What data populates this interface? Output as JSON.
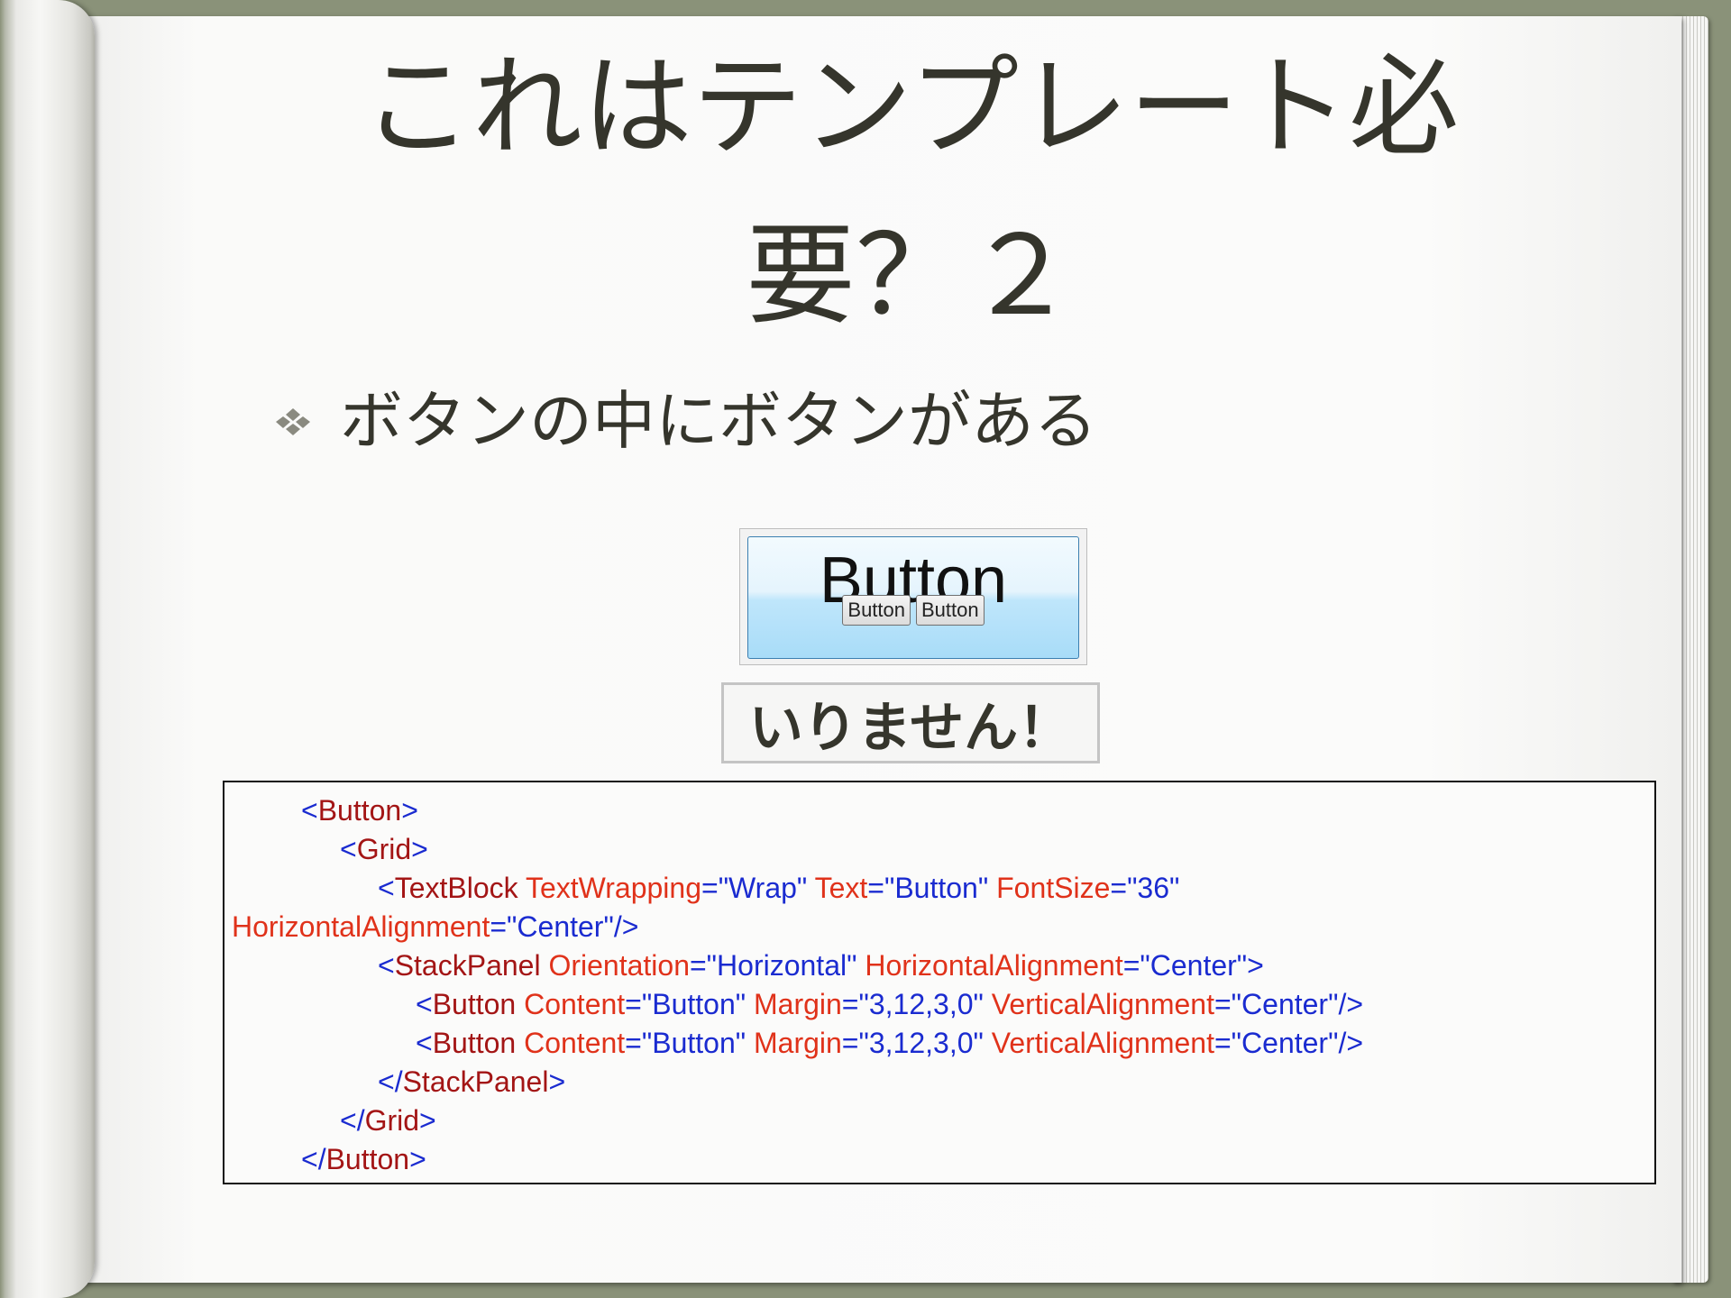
{
  "slide": {
    "title_line1": "これはテンプレート必",
    "title_line2": "要？２",
    "bullet_text": "ボタンの中にボタンがある",
    "bullet_icon": "diamond-cluster-icon"
  },
  "demo": {
    "big_text": "Button",
    "inner_buttons": [
      "Button",
      "Button"
    ]
  },
  "caption": "いりません！",
  "code_lines": [
    {
      "indent": 85,
      "tokens": [
        [
          "p",
          "<"
        ],
        [
          "t",
          "Button"
        ],
        [
          "p",
          ">"
        ]
      ]
    },
    {
      "indent": 128,
      "tokens": [
        [
          "p",
          "<"
        ],
        [
          "t",
          "Grid"
        ],
        [
          "p",
          ">"
        ]
      ]
    },
    {
      "indent": 170,
      "tokens": [
        [
          "p",
          "<"
        ],
        [
          "t",
          "TextBlock"
        ],
        [
          "p",
          " "
        ],
        [
          "a",
          "TextWrapping"
        ],
        [
          "p",
          "=\""
        ],
        [
          "v",
          "Wrap"
        ],
        [
          "p",
          "\" "
        ],
        [
          "a",
          "Text"
        ],
        [
          "p",
          "=\""
        ],
        [
          "v",
          "Button"
        ],
        [
          "p",
          "\" "
        ],
        [
          "a",
          "FontSize"
        ],
        [
          "p",
          "=\""
        ],
        [
          "v",
          "36"
        ],
        [
          "p",
          "\""
        ]
      ]
    },
    {
      "indent": 8,
      "tokens": [
        [
          "a",
          "HorizontalAlignment"
        ],
        [
          "p",
          "=\""
        ],
        [
          "v",
          "Center"
        ],
        [
          "p",
          "\"/>"
        ]
      ]
    },
    {
      "indent": 170,
      "tokens": [
        [
          "p",
          "<"
        ],
        [
          "t",
          "StackPanel"
        ],
        [
          "p",
          " "
        ],
        [
          "a",
          "Orientation"
        ],
        [
          "p",
          "=\""
        ],
        [
          "v",
          "Horizontal"
        ],
        [
          "p",
          "\" "
        ],
        [
          "a",
          "HorizontalAlignment"
        ],
        [
          "p",
          "=\""
        ],
        [
          "v",
          "Center"
        ],
        [
          "p",
          "\">"
        ]
      ]
    },
    {
      "indent": 212,
      "tokens": [
        [
          "p",
          "<"
        ],
        [
          "t",
          "Button"
        ],
        [
          "p",
          " "
        ],
        [
          "a",
          "Content"
        ],
        [
          "p",
          "=\""
        ],
        [
          "v",
          "Button"
        ],
        [
          "p",
          "\" "
        ],
        [
          "a",
          "Margin"
        ],
        [
          "p",
          "=\""
        ],
        [
          "v",
          "3,12,3,0"
        ],
        [
          "p",
          "\" "
        ],
        [
          "a",
          "VerticalAlignment"
        ],
        [
          "p",
          "=\""
        ],
        [
          "v",
          "Center"
        ],
        [
          "p",
          "\"/>"
        ]
      ]
    },
    {
      "indent": 212,
      "tokens": [
        [
          "p",
          "<"
        ],
        [
          "t",
          "Button"
        ],
        [
          "p",
          " "
        ],
        [
          "a",
          "Content"
        ],
        [
          "p",
          "=\""
        ],
        [
          "v",
          "Button"
        ],
        [
          "p",
          "\" "
        ],
        [
          "a",
          "Margin"
        ],
        [
          "p",
          "=\""
        ],
        [
          "v",
          "3,12,3,0"
        ],
        [
          "p",
          "\" "
        ],
        [
          "a",
          "VerticalAlignment"
        ],
        [
          "p",
          "=\""
        ],
        [
          "v",
          "Center"
        ],
        [
          "p",
          "\"/>"
        ]
      ]
    },
    {
      "indent": 170,
      "tokens": [
        [
          "p",
          "</"
        ],
        [
          "t",
          "StackPanel"
        ],
        [
          "p",
          ">"
        ]
      ]
    },
    {
      "indent": 128,
      "tokens": [
        [
          "p",
          "</"
        ],
        [
          "t",
          "Grid"
        ],
        [
          "p",
          ">"
        ]
      ]
    },
    {
      "indent": 85,
      "tokens": [
        [
          "p",
          "</"
        ],
        [
          "t",
          "Button"
        ],
        [
          "p",
          ">"
        ]
      ]
    }
  ]
}
